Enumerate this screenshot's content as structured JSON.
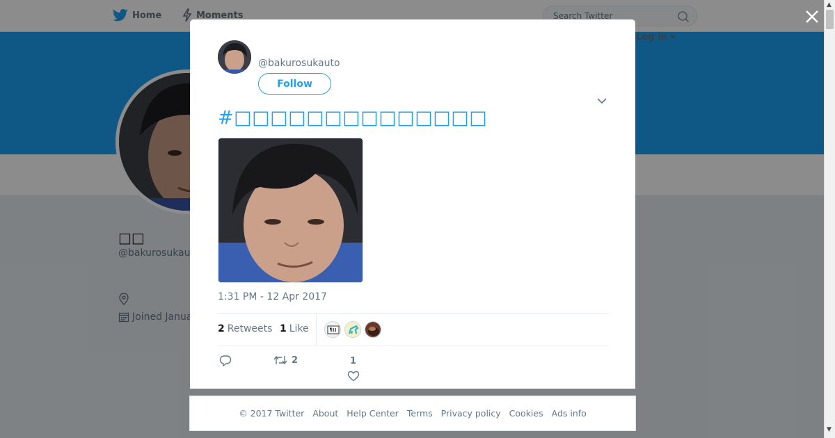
{
  "nav": {
    "home_label": "Home",
    "moments_label": "Moments",
    "search_placeholder": "Search Twitter",
    "login_label": "Log in ▾"
  },
  "profile": {
    "name": "□□",
    "handle": "@bakurosukauto",
    "joined": "Joined January"
  },
  "modal": {
    "handle": "@bakurosukauto",
    "follow_label": "Follow",
    "tweet_text": "#□□□□□□□□□□□□□□",
    "timestamp": "1:31 PM - 12 Apr 2017",
    "retweets_count": "2",
    "retweets_label": "Retweets",
    "likes_count": "1",
    "likes_label": "Like",
    "actions": {
      "retweet_count": "2",
      "like_count": "1"
    },
    "liker_avatars": [
      "liker-avatar-1",
      "liker-avatar-2",
      "liker-avatar-3"
    ]
  },
  "footer": {
    "links": [
      "© 2017 Twitter",
      "About",
      "Help Center",
      "Terms",
      "Privacy policy",
      "Cookies",
      "Ads info"
    ]
  },
  "colors": {
    "accent": "#1da1f2",
    "text_secondary": "#657786",
    "background": "#e6ecf0"
  }
}
